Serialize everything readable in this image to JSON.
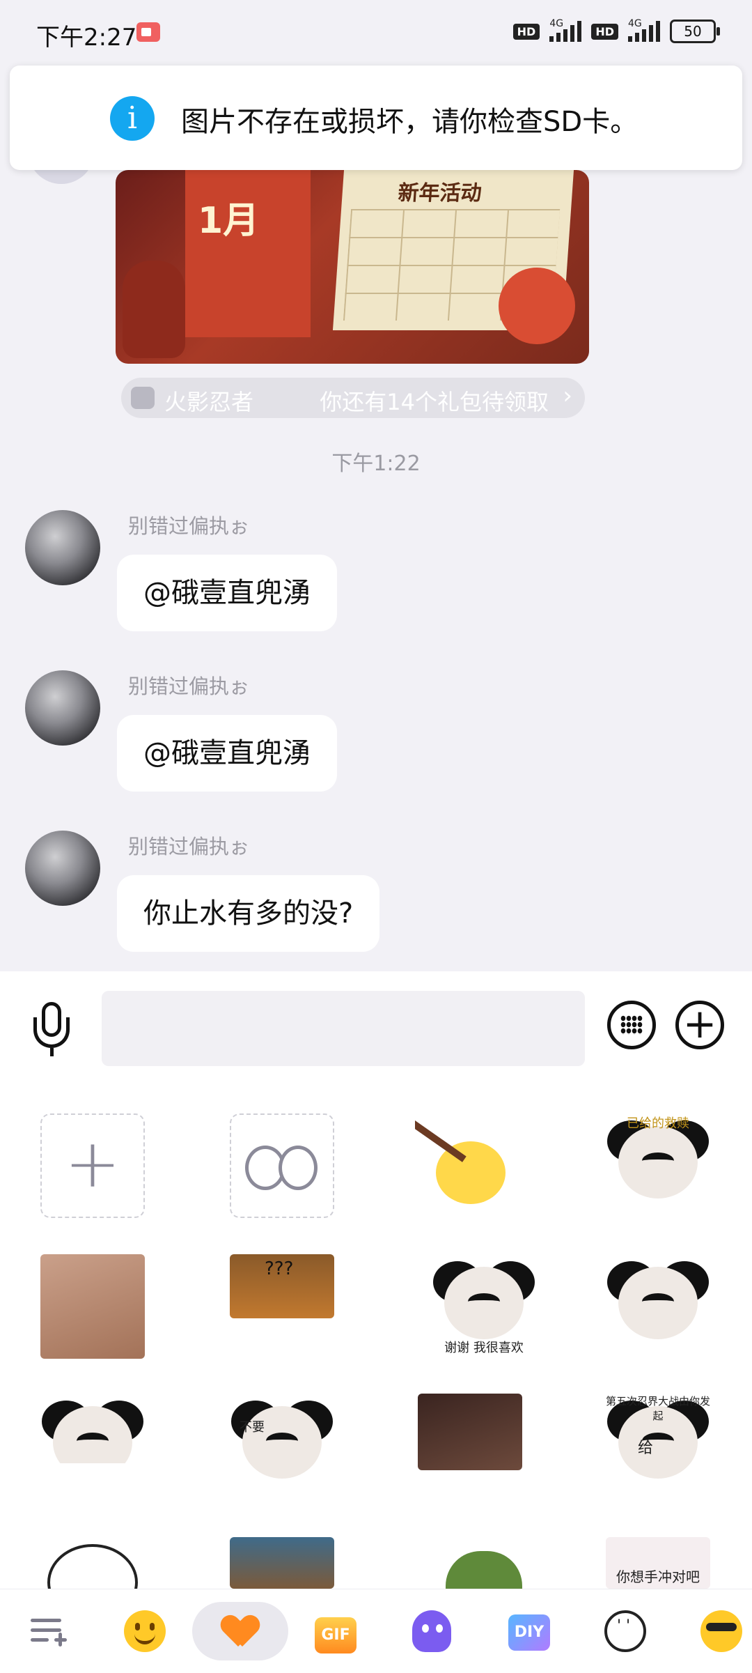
{
  "status_bar": {
    "time": "下午2:27",
    "hd1": "HD",
    "net1": "4G",
    "hd2": "HD",
    "net2": "4G",
    "battery": "50"
  },
  "toast": {
    "message": "图片不存在或损坏，请你检查SD卡。"
  },
  "share_card": {
    "month": "1月",
    "board_title": "新年活动",
    "game_name": "火影忍者",
    "gift_text": "你还有14个礼包待领取"
  },
  "chat": {
    "timestamp": "下午1:22",
    "messages": [
      {
        "sender": "别错过偏执ぉ",
        "text": "@硪壹直兜湧"
      },
      {
        "sender": "别错过偏执ぉ",
        "text": "@硪壹直兜湧"
      },
      {
        "sender": "别错过偏执ぉ",
        "text": "你止水有多的没?"
      }
    ]
  },
  "input": {
    "placeholder": ""
  },
  "stickers": {
    "captions": {
      "thanks": "谢谢 我很喜欢",
      "no": "不要",
      "give_top": "第五次忍界大战由你发起",
      "give": "给",
      "want": "你想手冲对吧",
      "gift_top": "已给的救赎",
      "scene": "???"
    }
  },
  "bottom_bar": {
    "gif_label": "GIF",
    "diy_label": "DIY"
  }
}
